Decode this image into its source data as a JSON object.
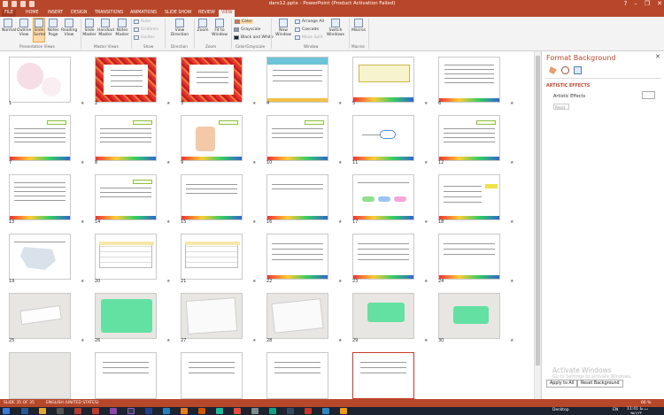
{
  "window": {
    "title": "dars12.pptx - PowerPoint (Product Activation Failed)",
    "help": "?",
    "minimize": "–",
    "maximize": "❐",
    "close": "✕"
  },
  "tabs": [
    {
      "label": "FILE"
    },
    {
      "label": "HOME"
    },
    {
      "label": "INSERT"
    },
    {
      "label": "DESIGN"
    },
    {
      "label": "TRANSITIONS"
    },
    {
      "label": "ANIMATIONS"
    },
    {
      "label": "SLIDE SHOW"
    },
    {
      "label": "REVIEW"
    },
    {
      "label": "VIEW"
    }
  ],
  "ribbon": {
    "presentation_views": {
      "group": "Presentation Views",
      "normal": "Normal",
      "outline": "Outline View",
      "slide_sorter": "Slide Sorter",
      "notes_page": "Notes Page",
      "reading_view": "Reading View"
    },
    "master_views": {
      "group": "Master Views",
      "slide_master": "Slide Master",
      "handout_master": "Handout Master",
      "notes_master": "Notes Master"
    },
    "show": {
      "group": "Show",
      "ruler": "Ruler",
      "gridlines": "Gridlines",
      "guides": "Guides"
    },
    "direction": {
      "group": "Direction",
      "view_direction": "View Direction"
    },
    "zoom": {
      "group": "Zoom",
      "zoom": "Zoom",
      "fit": "Fit to Window"
    },
    "color": {
      "group": "Color/Grayscale",
      "color": "Color",
      "grayscale": "Grayscale",
      "bw": "Black and White"
    },
    "window": {
      "group": "Window",
      "new_window": "New Window",
      "arrange": "Arrange All",
      "cascade": "Cascade",
      "move_split": "Move Split",
      "switch": "Switch Windows"
    },
    "macros": {
      "group": "Macros",
      "macros": "Macros"
    }
  },
  "slides": [
    {
      "n": "1"
    },
    {
      "n": "2"
    },
    {
      "n": "3"
    },
    {
      "n": "4"
    },
    {
      "n": "5"
    },
    {
      "n": "6"
    },
    {
      "n": "7"
    },
    {
      "n": "8"
    },
    {
      "n": "9"
    },
    {
      "n": "10"
    },
    {
      "n": "11"
    },
    {
      "n": "12"
    },
    {
      "n": "13"
    },
    {
      "n": "14"
    },
    {
      "n": "15"
    },
    {
      "n": "16"
    },
    {
      "n": "17"
    },
    {
      "n": "18"
    },
    {
      "n": "19"
    },
    {
      "n": "20"
    },
    {
      "n": "21"
    },
    {
      "n": "22"
    },
    {
      "n": "23"
    },
    {
      "n": "24"
    },
    {
      "n": "25"
    },
    {
      "n": "26"
    },
    {
      "n": "27"
    },
    {
      "n": "28"
    },
    {
      "n": "29"
    },
    {
      "n": "30"
    },
    {
      "n": ""
    },
    {
      "n": ""
    },
    {
      "n": ""
    },
    {
      "n": ""
    },
    {
      "n": ""
    },
    {
      "n": ""
    }
  ],
  "star_symbol": "★",
  "format_panel": {
    "title": "Format Background",
    "close": "✕",
    "section": "ARTISTIC EFFECTS",
    "effects_label": "Artistic Effects",
    "reset": "Reset",
    "apply_all": "Apply to All",
    "reset_background": "Reset Background"
  },
  "activation": {
    "line1": "Activate Windows",
    "line2": "Go to Settings to activate Windows."
  },
  "status": {
    "slide": "SLIDE 35 OF 35",
    "language": "ENGLISH (UNITED STATES)",
    "zoom": "66 %"
  },
  "taskbar": {
    "desktop": "Desktop",
    "lang": "EN",
    "time": "11:41 ب.ظ",
    "date": "۹۵/۱/۲۳"
  },
  "colors": {
    "accent": "#b7472a",
    "selected_slide_border": "#c23b2a",
    "green_note": "#62e1a2"
  }
}
